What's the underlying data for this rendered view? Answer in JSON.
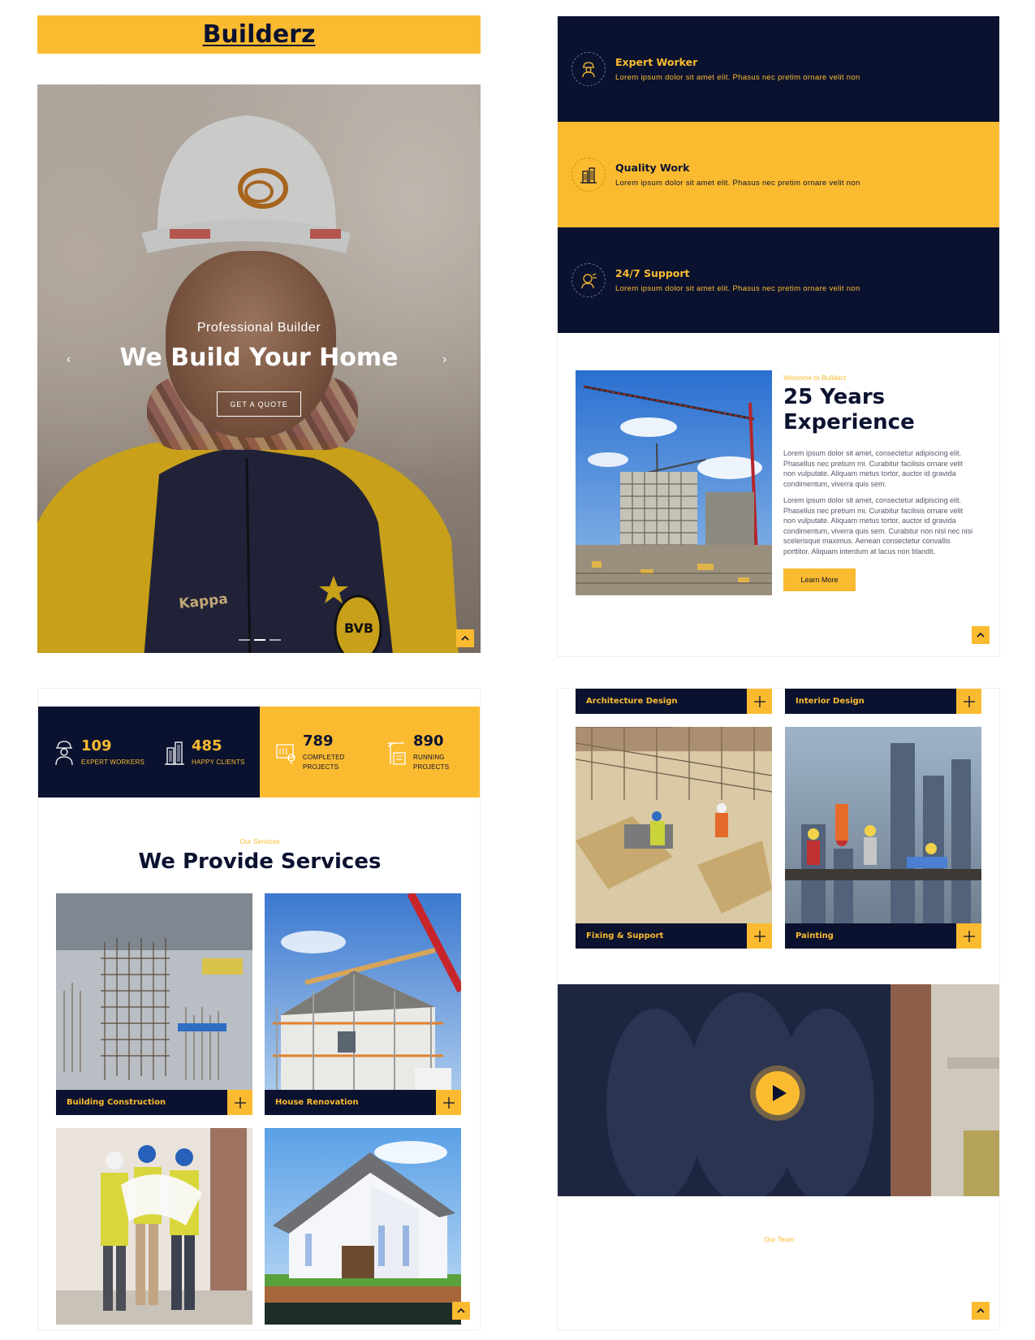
{
  "brand": {
    "name": "Builderz"
  },
  "hero": {
    "subtitle": "Professional Builder",
    "title": "We Build Your Home",
    "cta": "GET A QUOTE",
    "slide_active": 2,
    "slide_count": 3
  },
  "features": [
    {
      "title": "Expert Worker",
      "text": "Lorem ipsum dolor sit amet elit. Phasus nec pretim ornare velit non",
      "icon": "worker-icon"
    },
    {
      "title": "Quality Work",
      "text": "Lorem ipsum dolor sit amet elit. Phasus nec pretim ornare velit non",
      "icon": "building-icon"
    },
    {
      "title": "24/7 Support",
      "text": "Lorem ipsum dolor sit amet elit. Phasus nec pretim ornare velit non",
      "icon": "support-icon"
    }
  ],
  "about": {
    "eyebrow": "Welcome to Builderz",
    "title": "25 Years Experience",
    "p1": "Lorem ipsum dolor sit amet, consectetur adipiscing elit. Phasellus nec pretium mi. Curabitur facilisis ornare velit non vulputate. Aliquam metus tortor, auctor id gravida condimentum, viverra quis sem.",
    "p2": "Lorem ipsum dolor sit amet, consectetur adipiscing elit. Phasellus nec pretium mi. Curabitur facilisis ornare velit non vulputate. Aliquam metus tortor, auctor id gravida condimentum, viverra quis sem. Curabitur non nisl nec nisi scelerisque maximus. Aenean consectetur convallis porttitor. Aliquam interdum at lacus non blandit.",
    "button": "Learn More"
  },
  "stats": [
    {
      "number": "109",
      "label": "EXPERT WORKERS",
      "icon": "worker-icon"
    },
    {
      "number": "485",
      "label": "HAPPY CLIENTS",
      "icon": "building-icon"
    },
    {
      "number": "789",
      "label": "COMPLETED PROJECTS",
      "icon": "blueprint-icon"
    },
    {
      "number": "890",
      "label": "RUNNING PROJECTS",
      "icon": "crane-icon"
    }
  ],
  "services": {
    "eyebrow": "Our Services",
    "title": "We Provide Services",
    "items": [
      {
        "label": "Building Construction"
      },
      {
        "label": "House Renovation"
      },
      {
        "label": ""
      },
      {
        "label": ""
      }
    ]
  },
  "more_services": [
    {
      "label": "Architecture Design"
    },
    {
      "label": "Interior Design"
    },
    {
      "label": "Fixing & Support"
    },
    {
      "label": "Painting"
    }
  ],
  "team": {
    "eyebrow": "Our Team"
  },
  "colors": {
    "navy": "#0b1230",
    "gold": "#fbbb30"
  }
}
